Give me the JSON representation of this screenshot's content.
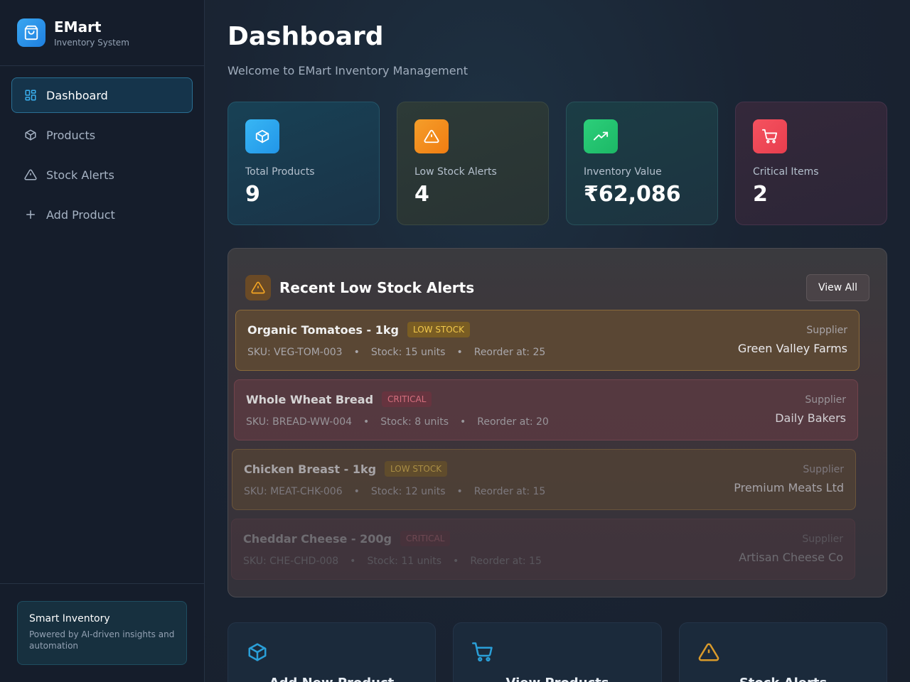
{
  "app": {
    "name": "EMart",
    "subtitle": "Inventory System"
  },
  "nav": [
    {
      "label": "Dashboard",
      "icon": "dashboard-grid-icon",
      "active": true
    },
    {
      "label": "Products",
      "icon": "box-icon"
    },
    {
      "label": "Stock Alerts",
      "icon": "warning-icon"
    },
    {
      "label": "Add Product",
      "icon": "plus-icon"
    }
  ],
  "sidebar_footer": {
    "title": "Smart Inventory",
    "description": "Powered by AI-driven insights and automation"
  },
  "page": {
    "title": "Dashboard",
    "subtitle": "Welcome to EMart Inventory Management"
  },
  "stats": [
    {
      "label": "Total Products",
      "value": "9",
      "icon": "box-icon",
      "color": "#2296e8"
    },
    {
      "label": "Low Stock Alerts",
      "value": "4",
      "icon": "warning-icon",
      "color": "#f07d12"
    },
    {
      "label": "Inventory Value",
      "value": "₹62,086",
      "icon": "trending-up-icon",
      "color": "#1cb866"
    },
    {
      "label": "Critical Items",
      "value": "2",
      "icon": "cart-icon",
      "color": "#e83e4e"
    }
  ],
  "alerts": {
    "title": "Recent Low Stock Alerts",
    "view_all_label": "View All",
    "supplier_label": "Supplier",
    "items": [
      {
        "name": "Organic Tomatoes - 1kg",
        "status": "LOW STOCK",
        "sku": "SKU: VEG-TOM-003",
        "stock": "Stock: 15 units",
        "reorder": "Reorder at: 25",
        "supplier": "Green Valley Farms"
      },
      {
        "name": "Whole Wheat Bread",
        "status": "CRITICAL",
        "sku": "SKU: BREAD-WW-004",
        "stock": "Stock: 8 units",
        "reorder": "Reorder at: 20",
        "supplier": "Daily Bakers"
      },
      {
        "name": "Chicken Breast - 1kg",
        "status": "LOW STOCK",
        "sku": "SKU: MEAT-CHK-006",
        "stock": "Stock: 12 units",
        "reorder": "Reorder at: 15",
        "supplier": "Premium Meats Ltd"
      },
      {
        "name": "Cheddar Cheese - 200g",
        "status": "CRITICAL",
        "sku": "SKU: CHE-CHD-008",
        "stock": "Stock: 11 units",
        "reorder": "Reorder at: 15",
        "supplier": "Artisan Cheese Co"
      }
    ]
  },
  "actions": [
    {
      "label": "Add New Product",
      "icon": "box-icon"
    },
    {
      "label": "View Products",
      "icon": "cart-icon"
    },
    {
      "label": "Stock Alerts",
      "icon": "warning-icon"
    }
  ],
  "separator": "•"
}
